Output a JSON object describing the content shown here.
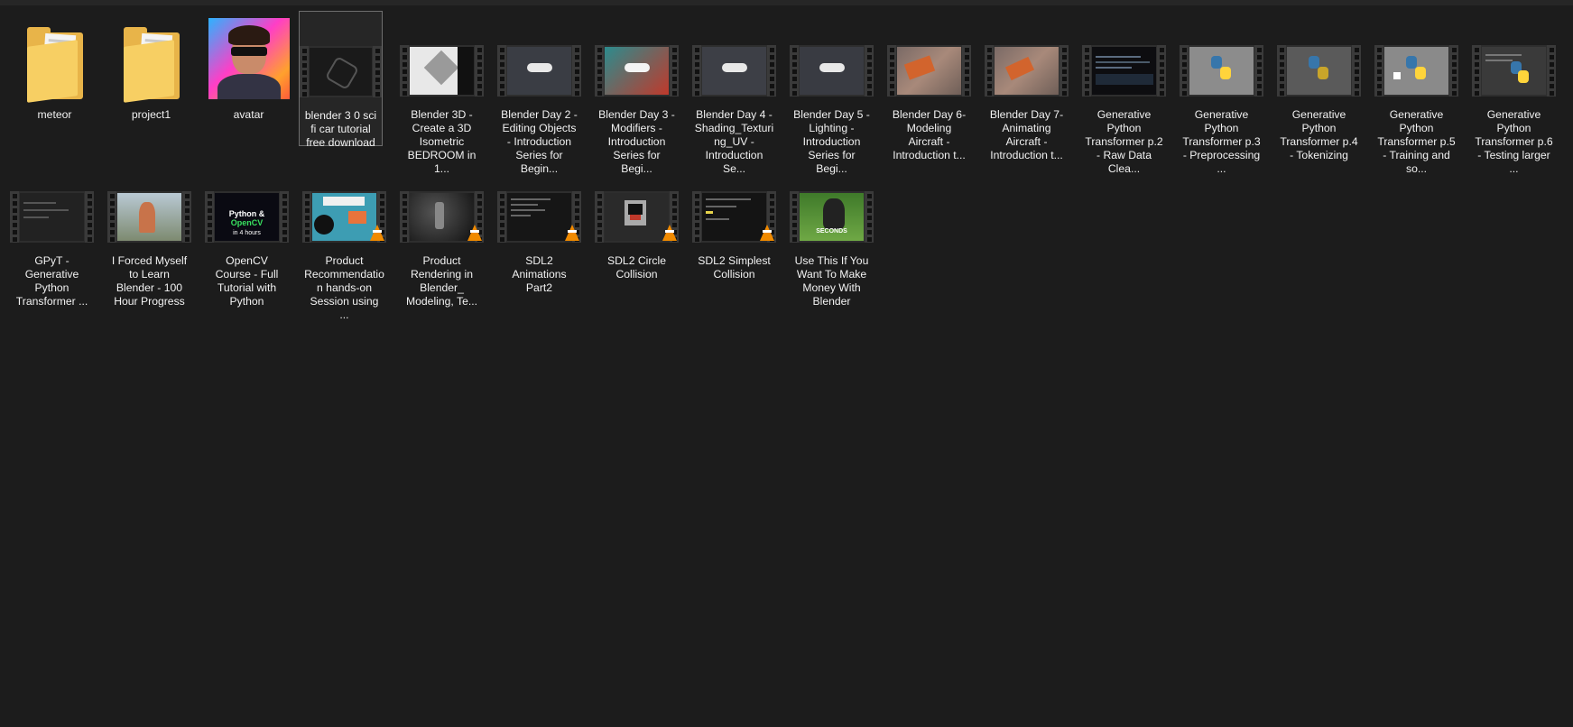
{
  "items": [
    {
      "label": "meteor",
      "kind": "folder"
    },
    {
      "label": "project1",
      "kind": "folder"
    },
    {
      "label": "avatar",
      "kind": "image"
    },
    {
      "label": "blender 3 0 sci fi car tutorial free download",
      "kind": "video",
      "selected": true
    },
    {
      "label": "Blender 3D - Create a 3D Isometric BEDROOM in 1...",
      "kind": "video"
    },
    {
      "label": "Blender Day 2 - Editing Objects - Introduction Series for Begin...",
      "kind": "video"
    },
    {
      "label": "Blender Day 3 - Modifiers - Introduction Series for Begi...",
      "kind": "video"
    },
    {
      "label": "Blender Day 4 - Shading_Texturing_UV - Introduction Se...",
      "kind": "video"
    },
    {
      "label": "Blender Day 5 - Lighting - Introduction Series for Begi...",
      "kind": "video"
    },
    {
      "label": "Blender Day 6- Modeling Aircraft - Introduction t...",
      "kind": "video"
    },
    {
      "label": "Blender Day 7- Animating Aircraft - Introduction t...",
      "kind": "video"
    },
    {
      "label": "Generative Python Transformer p.2 - Raw Data Clea...",
      "kind": "video"
    },
    {
      "label": "Generative Python Transformer p.3 - Preprocessing ...",
      "kind": "video"
    },
    {
      "label": "Generative Python Transformer p.4 - Tokenizing",
      "kind": "video"
    },
    {
      "label": "Generative Python Transformer p.5 - Training and so...",
      "kind": "video"
    },
    {
      "label": "Generative Python Transformer p.6 - Testing larger ...",
      "kind": "video"
    },
    {
      "label": "GPyT - Generative Python Transformer ...",
      "kind": "video"
    },
    {
      "label": "I Forced Myself to Learn Blender - 100 Hour Progress",
      "kind": "video"
    },
    {
      "label": "OpenCV Course - Full Tutorial with Python",
      "kind": "video",
      "thumb_text": "Python & ",
      "thumb_text_accent": "OpenCV",
      "thumb_text2": "in 4 hours"
    },
    {
      "label": "Product Recommendation hands-on Session using ...",
      "kind": "video",
      "vlc": true
    },
    {
      "label": "Product Rendering in Blender_ Modeling, Te...",
      "kind": "video",
      "vlc": true
    },
    {
      "label": "SDL2 Animations Part2",
      "kind": "video",
      "vlc": true
    },
    {
      "label": "SDL2 Circle Collision",
      "kind": "video",
      "vlc": true
    },
    {
      "label": "SDL2 Simplest Collision",
      "kind": "video",
      "vlc": true
    },
    {
      "label": "Use This If You Want To Make Money With Blender",
      "kind": "video",
      "thumb_text": "SECONDS"
    }
  ],
  "colors": {
    "background": "#1c1c1c",
    "text": "#f2f2f2",
    "folder": "#e8b449",
    "vlc_cone": "#f08a00"
  }
}
